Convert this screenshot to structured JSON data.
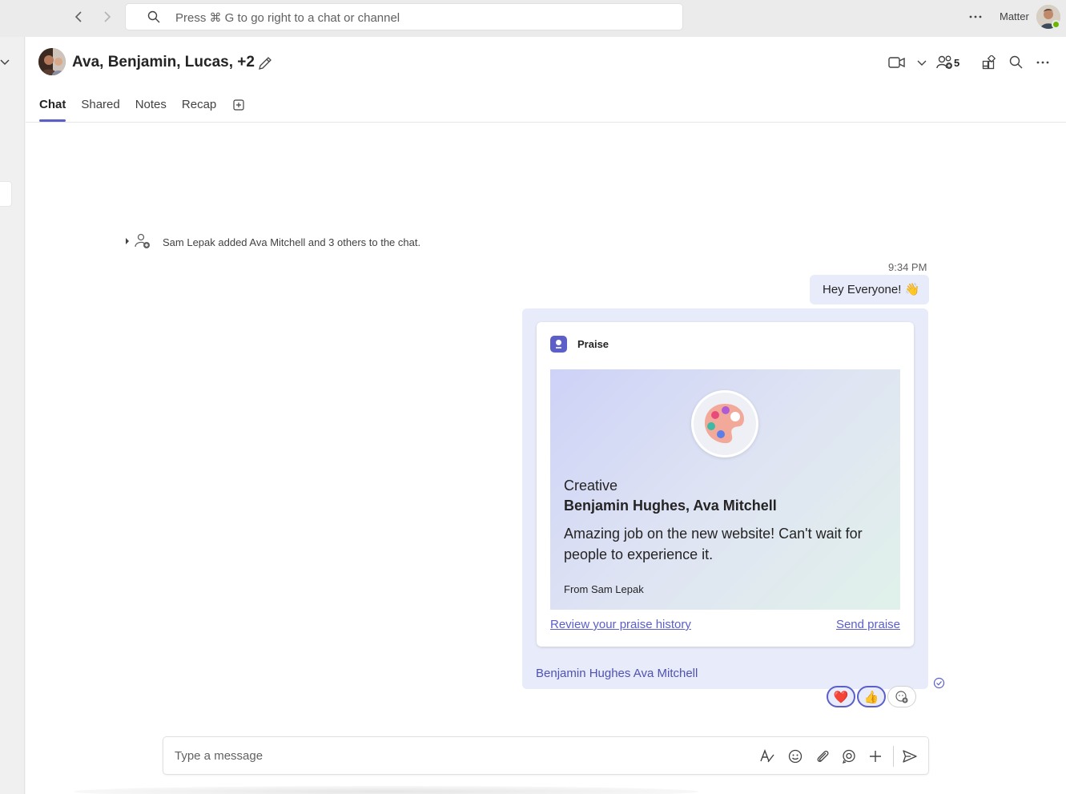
{
  "topbar": {
    "search_placeholder": "Press ⌘ G to go right to a chat or channel",
    "org_name": "Matter"
  },
  "chat": {
    "title": "Ava, Benjamin, Lucas, +2",
    "participant_count": "5",
    "tabs": [
      {
        "label": "Chat",
        "active": true
      },
      {
        "label": "Shared",
        "active": false
      },
      {
        "label": "Notes",
        "active": false
      },
      {
        "label": "Recap",
        "active": false
      }
    ]
  },
  "system_message": {
    "text": "Sam Lepak added Ava Mitchell and 3 others to the chat."
  },
  "message": {
    "time": "9:34 PM",
    "text": "Hey Everyone! 👋"
  },
  "praise_card": {
    "app_name": "Praise",
    "badge_icon": "palette-icon",
    "type": "Creative",
    "recipients": "Benjamin Hughes, Ava Mitchell",
    "message": "Amazing job on the new website! Can't wait for people to experience it.",
    "from": "From Sam Lepak",
    "review_link": "Review your praise history",
    "send_link": "Send praise",
    "mentioned": "Benjamin Hughes Ava Mitchell"
  },
  "reactions": [
    {
      "emoji": "❤️",
      "icon": "heart-icon",
      "mine": true
    },
    {
      "emoji": "👍",
      "icon": "thumbs-up-icon",
      "mine": true
    }
  ],
  "composer": {
    "placeholder": "Type a message"
  },
  "colors": {
    "accent": "#5b5fc7",
    "bubble": "#e8ebfa",
    "presence": "#6bb700"
  }
}
